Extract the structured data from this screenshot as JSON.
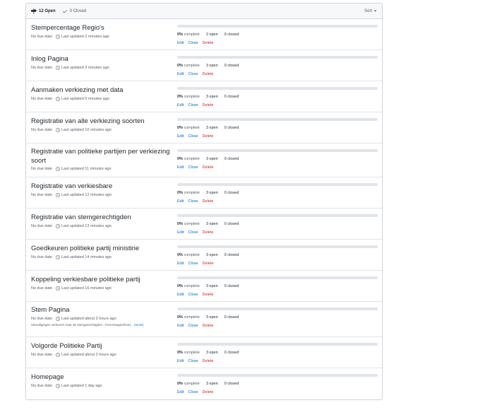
{
  "header": {
    "open_label": "12 Open",
    "closed_label": "0 Closed",
    "sort_label": "Sort"
  },
  "milestones": [
    {
      "title": "Stempercentage Regio's",
      "due": "No due date",
      "updated": "Last updated 2 minutes ago",
      "percent": "0%",
      "complete_label": "complete",
      "open": "2 open",
      "closed": "0 closed",
      "progress": 0,
      "description": ""
    },
    {
      "title": "Inlog Pagina",
      "due": "No due date",
      "updated": "Last updated 3 minutes ago",
      "percent": "0%",
      "complete_label": "complete",
      "open": "3 open",
      "closed": "0 closed",
      "progress": 0,
      "description": ""
    },
    {
      "title": "Aanmaken verkiezing met data",
      "due": "No due date",
      "updated": "Last updated 5 minutes ago",
      "percent": "0%",
      "complete_label": "complete",
      "open": "3 open",
      "closed": "0 closed",
      "progress": 0,
      "description": ""
    },
    {
      "title": "Registratie van alle verkiezing soorten",
      "due": "No due date",
      "updated": "Last updated 10 minutes ago",
      "percent": "0%",
      "complete_label": "complete",
      "open": "3 open",
      "closed": "0 closed",
      "progress": 0,
      "description": ""
    },
    {
      "title": "Registratie van politieke partijen per verkiezing soort",
      "due": "No due date",
      "updated": "Last updated 11 minutes ago",
      "percent": "0%",
      "complete_label": "complete",
      "open": "3 open",
      "closed": "0 closed",
      "progress": 0,
      "description": ""
    },
    {
      "title": "Registratie van verkiesbare",
      "due": "No due date",
      "updated": "Last updated 12 minutes ago",
      "percent": "0%",
      "complete_label": "complete",
      "open": "3 open",
      "closed": "0 closed",
      "progress": 0,
      "description": ""
    },
    {
      "title": "Registratie van stemgerechtigden",
      "due": "No due date",
      "updated": "Last updated 13 minutes ago",
      "percent": "0%",
      "complete_label": "complete",
      "open": "3 open",
      "closed": "0 closed",
      "progress": 0,
      "description": ""
    },
    {
      "title": "Goedkeuren politieke partij ministirie",
      "due": "No due date",
      "updated": "Last updated 14 minutes ago",
      "percent": "0%",
      "complete_label": "complete",
      "open": "3 open",
      "closed": "0 closed",
      "progress": 0,
      "description": ""
    },
    {
      "title": "Koppeling verkiesbare politieke partij",
      "due": "No due date",
      "updated": "Last updated 16 minutes ago",
      "percent": "0%",
      "complete_label": "complete",
      "open": "3 open",
      "closed": "0 closed",
      "progress": 0,
      "description": ""
    },
    {
      "title": "Stem Pagina",
      "due": "No due date",
      "updated": "Last updated about 2 hours ago",
      "percent": "0%",
      "complete_label": "complete",
      "open": "3 open",
      "closed": "0 closed",
      "progress": 0,
      "description": "Uitnodigingen versturen naar de stemgerechtigden - Percentages/hoev...",
      "more": "(more)"
    },
    {
      "title": "Volgorde Politieke Partij",
      "due": "No due date",
      "updated": "Last updated about 2 hours ago",
      "percent": "0%",
      "complete_label": "complete",
      "open": "3 open",
      "closed": "0 closed",
      "progress": 0,
      "description": ""
    },
    {
      "title": "Homepage",
      "due": "No due date",
      "updated": "Last updated 1 day ago",
      "percent": "0%",
      "complete_label": "complete",
      "open": "3 open",
      "closed": "0 closed",
      "progress": 0,
      "description": ""
    }
  ],
  "actions": {
    "edit": "Edit",
    "close": "Close",
    "delete": "Delete"
  },
  "colors": {
    "link": "#0366d6",
    "danger": "#cb2431",
    "muted": "#586069",
    "border": "#d1d5da"
  },
  "icons": {
    "open": "milestone-icon",
    "closed": "check-icon",
    "updated": "clock-icon",
    "sort": "chevron-down-icon"
  }
}
